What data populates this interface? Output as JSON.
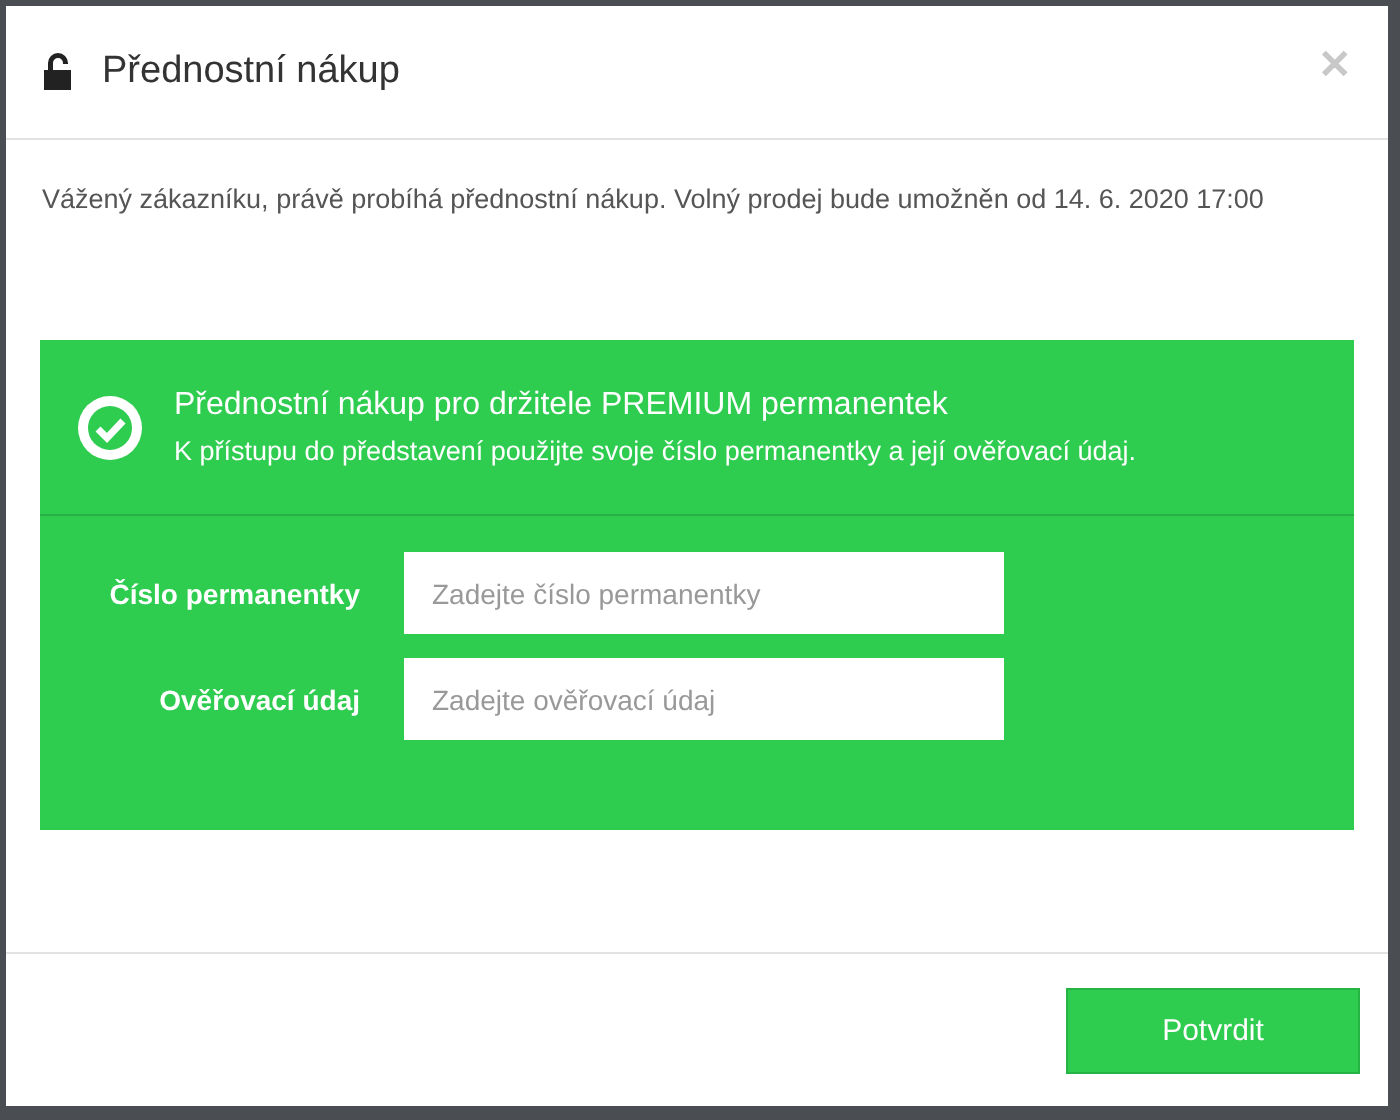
{
  "dialog": {
    "title": "Přednostní nákup",
    "close": "✕"
  },
  "message": "Vážený zákazníku, právě probíhá přednostní nákup. Volný prodej bude umožněn od 14. 6. 2020 17:00",
  "panel": {
    "heading": "Přednostní nákup pro držitele PREMIUM permanentek",
    "subtext": "K přístupu do představení použijte svoje číslo permanentky a její ověřovací údaj.",
    "fields": [
      {
        "label": "Číslo permanentky",
        "placeholder": "Zadejte číslo permanentky"
      },
      {
        "label": "Ověřovací údaj",
        "placeholder": "Zadejte ověřovací údaj"
      }
    ]
  },
  "buttons": [
    "Potvrdit"
  ]
}
